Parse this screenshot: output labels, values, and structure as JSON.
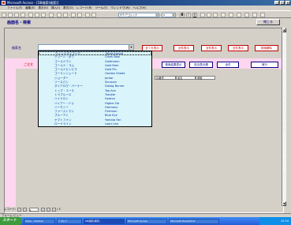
{
  "window": {
    "title": "Microsoft Access - [DB検索(検索)]",
    "controls": [
      "_",
      "□",
      "×"
    ]
  },
  "menu": [
    "ファイル(F)",
    "編集(E)",
    "表示(V)",
    "挿入(I)",
    "書式(O)",
    "レコード(R)",
    "ツール(T)",
    "ウィンドウ(W)",
    "ヘルプ(H)"
  ],
  "toolbar": {
    "font_name": "ＭＳ Ｐゴシック",
    "font_size": "9",
    "style_buttons": [
      "B",
      "I",
      "U"
    ]
  },
  "form": {
    "title": "画面名・検索",
    "close_label": "閉じる",
    "search_label": "検索名",
    "search_value": "",
    "row_label": "ご注文",
    "red_buttons": [
      "全てを表示",
      "全件表示",
      "全件表示",
      "検索解除"
    ],
    "blue_buttons": [
      "検索結果表示",
      "該当表示順",
      "全件"
    ],
    "blue_action_label": "実行",
    "column_headers": [
      "ID番号",
      "品名",
      "単価"
    ]
  },
  "dropdown": {
    "items": [
      {
        "jp": "ウィンドダイアーク",
        "en": "Wind Armed"
      },
      {
        "jp": "クリーン・ボウ",
        "en": "Clean Bow"
      },
      {
        "jp": "ゴールドマン",
        "en": "Goldmann"
      },
      {
        "jp": "ゴールド・ラム",
        "en": "Gold Ram"
      },
      {
        "jp": "ゴールドビンビラ",
        "en": "Gold Pin"
      },
      {
        "jp": "ゴードンシェード",
        "en": "Gordon Shade"
      },
      {
        "jp": "ジョーダー",
        "en": "Jordar"
      },
      {
        "jp": "ソースパン",
        "en": "Sourpan"
      },
      {
        "jp": "ダイアログ・バーナー",
        "en": "Dialog Burner"
      },
      {
        "jp": "トップ・エース",
        "en": "Top Ace"
      },
      {
        "jp": "トラブルース",
        "en": "Trouble"
      },
      {
        "jp": "ハイドロン",
        "en": "Hydron"
      },
      {
        "jp": "ハイアー・ドゥ",
        "en": "Higher Do"
      },
      {
        "jp": "ハーモニー",
        "en": "Harmony"
      },
      {
        "jp": "ファーストマン",
        "en": "Firstman"
      },
      {
        "jp": "ブルーアイ",
        "en": "Blue Eye"
      },
      {
        "jp": "ヤマトファン",
        "en": "Yamato Fan"
      },
      {
        "jp": "ロードライン",
        "en": "Load Line"
      }
    ]
  },
  "record_nav": {
    "label": "レコード:",
    "current": "1",
    "total_text": "/ 3"
  },
  "status": "フォーム ビュー",
  "taskbar": {
    "start": "スタート",
    "tasks": [
      "Inbox - Outlook",
      "ﾃﾞｽｸﾄｯﾌﾟ",
      "DB検索(検索)",
      "Microsoft Access",
      "Microsoft PowerPoint"
    ],
    "clock": "15:34"
  },
  "colors": {
    "title_gradient_start": "#0a246a",
    "form_title": "#000080",
    "pink_band": "#ffd6ef",
    "dropdown_bg": "#d9f5fb",
    "red_button": "#c00000",
    "taskbar": "#245edb"
  }
}
